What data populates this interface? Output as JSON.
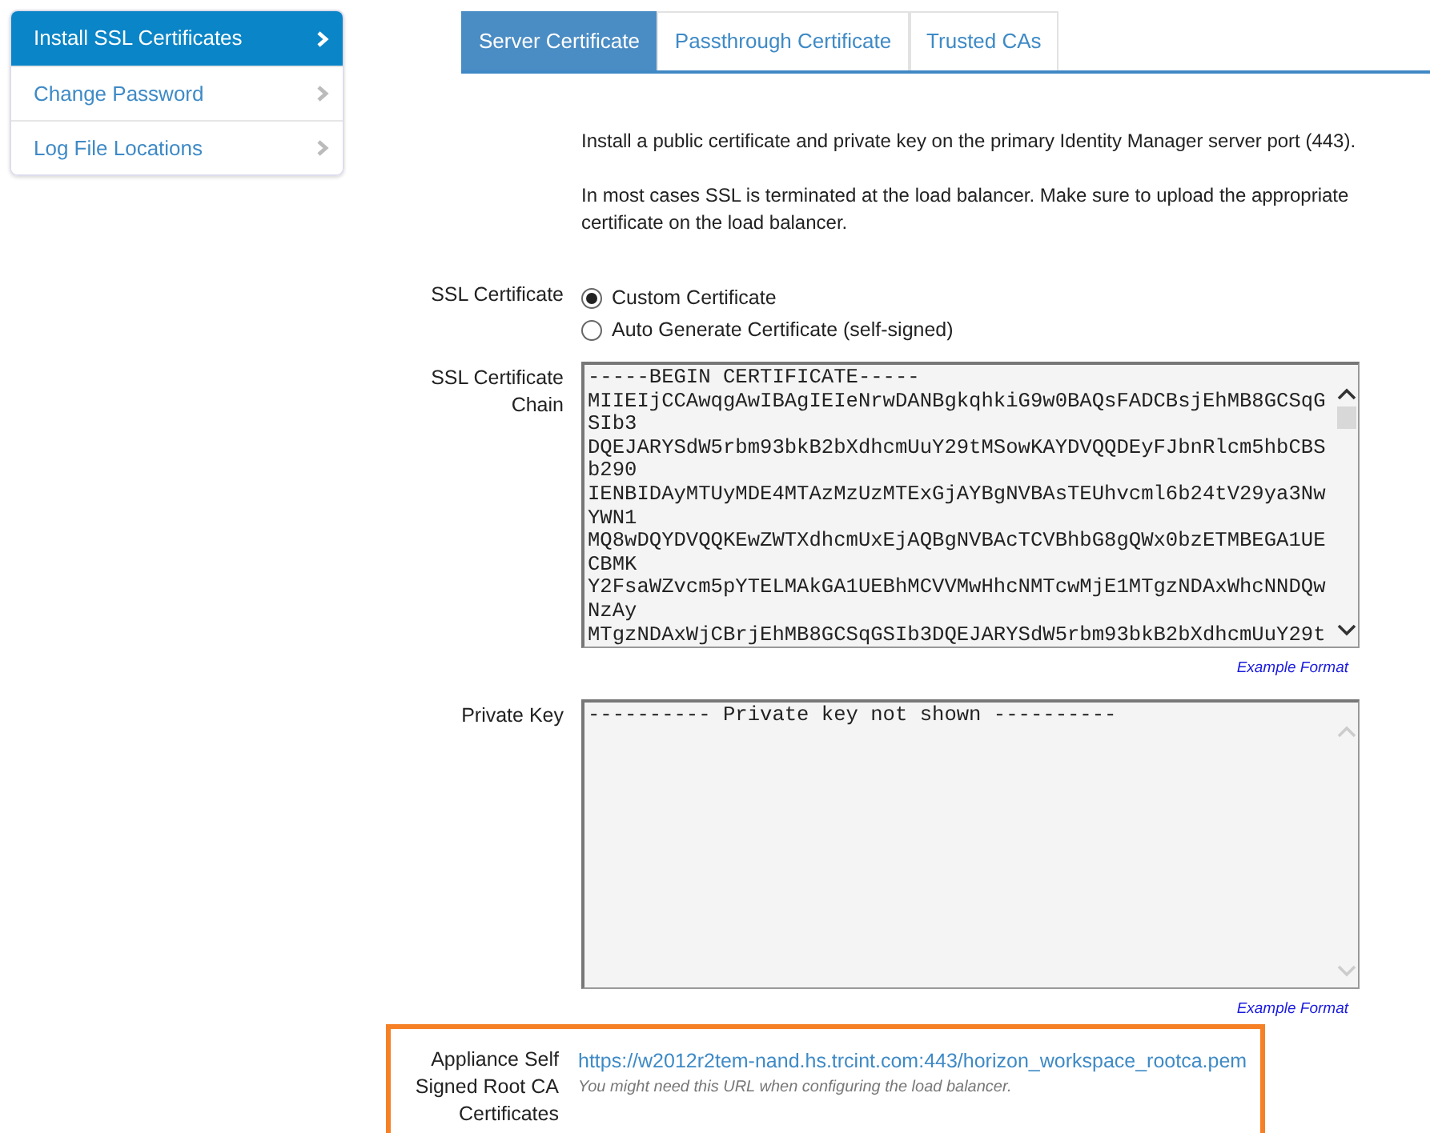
{
  "sidebar": {
    "items": [
      {
        "label": "Install SSL Certificates",
        "selected": true
      },
      {
        "label": "Change Password",
        "selected": false
      },
      {
        "label": "Log File Locations",
        "selected": false
      }
    ]
  },
  "tabs": [
    {
      "label": "Server Certificate",
      "selected": true
    },
    {
      "label": "Passthrough Certificate",
      "selected": false
    },
    {
      "label": "Trusted CAs",
      "selected": false
    }
  ],
  "intro": [
    "Install a public certificate and private key on the primary Identity Manager server port (443).",
    "In most cases SSL is terminated at the load balancer. Make sure to upload the appropriate certificate on the load balancer."
  ],
  "ssl_certificate": {
    "label": "SSL Certificate",
    "options": [
      {
        "label": "Custom Certificate",
        "selected": true
      },
      {
        "label": "Auto Generate Certificate (self-signed)",
        "selected": false
      }
    ]
  },
  "fields": [
    {
      "label": "SSL Certificate Chain",
      "scrollable": true,
      "example_link": "Example Format",
      "value": "-----BEGIN CERTIFICATE-----\nMIIEIjCCAwqgAwIBAgIEIeNrwDANBgkqhkiG9w0BAQsFADCBsjEhMB8GCSqG\nSIb3\nDQEJARYSdW5rbm93bkB2bXdhcmUuY29tMSowKAYDVQQDEyFJbnRlcm5hbCBS\nb290\nIENBIDAyMTUyMDE4MTAzMzUzMTExGjAYBgNVBAsTEUhvcml6b24tV29ya3Nw\nYWN1\nMQ8wDQYDVQQKEwZWTXdhcmUxEjAQBgNVBAcTCVBhbG8gQWx0bzETMBEGA1UE\nCBMK\nY2FsaWZvcm5pYTELMAkGA1UEBhMCVVMwHhcNMTcwMjE1MTgzNDAxWhcNNDQw\nNzAy\nMTgzNDAxWjCBrjEhMB8GCSqGSIb3DQEJARYSdW5rbm93bkB2bXdhcmUuY29t"
    },
    {
      "label": "Private Key",
      "scrollable": false,
      "example_link": "Example Format",
      "value": "---------- Private key not shown ----------"
    }
  ],
  "root_ca": {
    "label": "Appliance Self Signed Root CA Certificates",
    "url": "https://w2012r2tem-nand.hs.trcint.com:443/horizon_workspace_rootca.pem",
    "hint": "You might need this URL when configuring the load balancer.",
    "highlighted": true
  }
}
